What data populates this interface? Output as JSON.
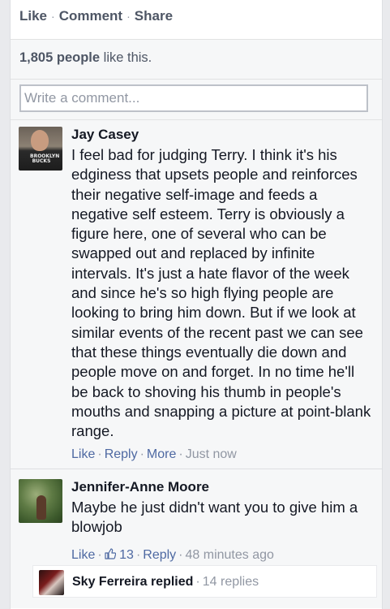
{
  "actions": {
    "like": "Like",
    "comment": "Comment",
    "share": "Share",
    "separator": "·"
  },
  "likes": {
    "count": "1,805 people",
    "suffix": " like this."
  },
  "write_comment": {
    "placeholder": "Write a comment..."
  },
  "comments": [
    {
      "author": "Jay Casey",
      "avatar_shirt_text": "BROOKLYN BUCKS",
      "text": "I feel bad for judging Terry. I think it's his edginess that upsets people and reinforces their negative self-image and feeds a negative self esteem. Terry is obviously a figure here, one of several who can be swapped out and replaced by infinite intervals. It's just a hate flavor of the week and since he's so high flying people are looking to bring him down. But if we look at similar events of the recent past we can see that these things eventually die down and people move on and forget. In no time he'll be back to shoving his thumb in people's mouths and snapping a picture at point-blank range.",
      "like_label": "Like",
      "reply_label": "Reply",
      "more_label": "More",
      "timestamp": "Just now"
    },
    {
      "author": "Jennifer-Anne Moore",
      "text": "Maybe he just didn't want you to give him a blowjob",
      "like_label": "Like",
      "like_count": "13",
      "reply_label": "Reply",
      "timestamp": "48 minutes ago"
    }
  ],
  "reply_summary": {
    "who": "Sky Ferreira replied",
    "count": "14 replies"
  },
  "colors": {
    "link": "#4e69a2",
    "muted": "#9197a3",
    "text": "#141823",
    "background": "#e9eaed"
  }
}
